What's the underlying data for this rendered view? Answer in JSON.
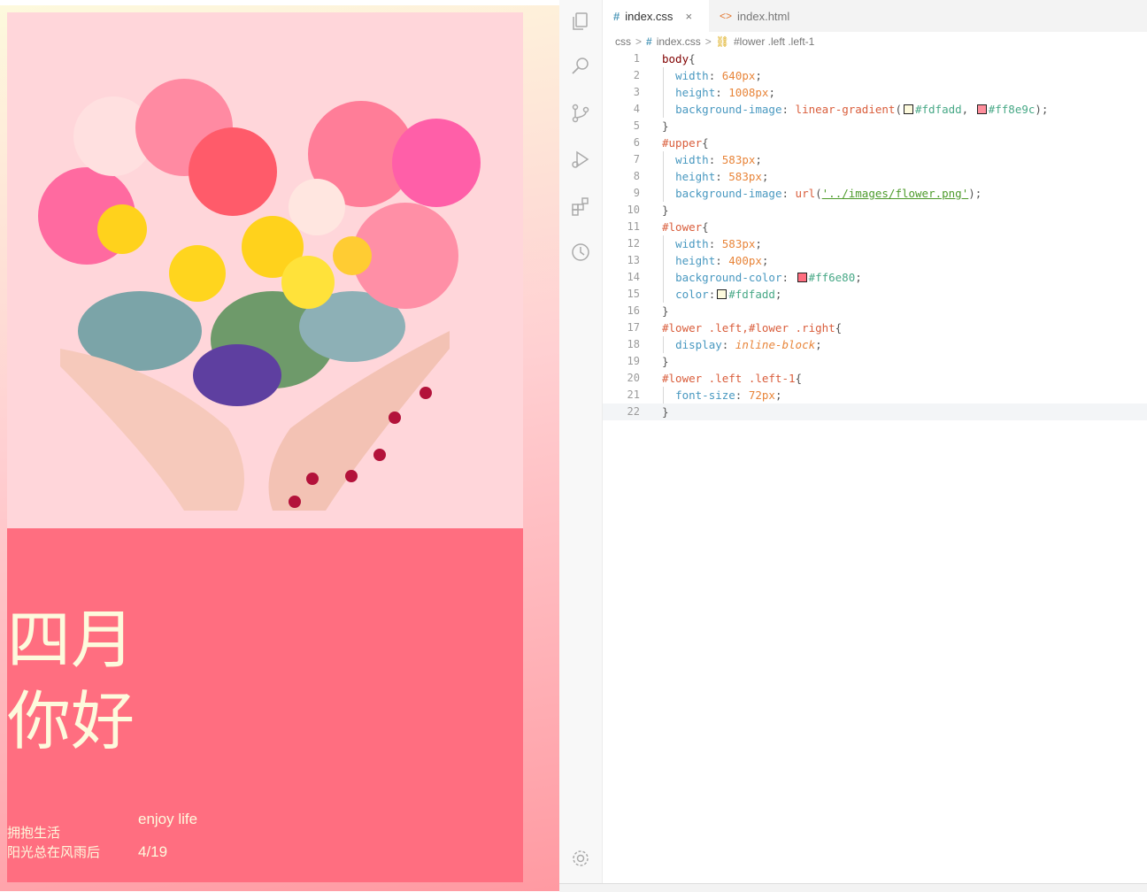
{
  "preview": {
    "heading_line1": "四月",
    "heading_line2": "你好",
    "left_line1": "拥抱生活",
    "left_line2": "阳光总在风雨后",
    "right_line1": "enjoy life",
    "right_line2": "4/19",
    "colors": {
      "body_gradient_start": "#fdfadd",
      "body_gradient_end": "#ff8e9c",
      "lower_bg": "#ff6e80",
      "text": "#fdfadd"
    }
  },
  "activity_bar": {
    "icons": [
      "files-icon",
      "search-icon",
      "source-control-icon",
      "run-debug-icon",
      "extensions-icon",
      "timeline-icon",
      "settings-gear-icon"
    ]
  },
  "tabs": [
    {
      "label": "index.css",
      "icon": "css-hash-icon",
      "active": true,
      "close": "×"
    },
    {
      "label": "index.html",
      "icon": "html-angle-icon",
      "active": false
    }
  ],
  "breadcrumb": {
    "folder": "css",
    "file": "index.css",
    "symbol": "#lower .left .left-1",
    "sep": ">"
  },
  "code": {
    "lines": [
      {
        "n": "1",
        "tokens": [
          [
            "sel",
            "body"
          ],
          [
            "pun",
            "{"
          ]
        ]
      },
      {
        "n": "2",
        "tokens": [
          [
            "prop",
            "width"
          ],
          [
            "pun",
            ": "
          ],
          [
            "num",
            "640px"
          ],
          [
            "pun",
            ";"
          ]
        ],
        "indent": true
      },
      {
        "n": "3",
        "tokens": [
          [
            "prop",
            "height"
          ],
          [
            "pun",
            ": "
          ],
          [
            "num",
            "1008px"
          ],
          [
            "pun",
            ";"
          ]
        ],
        "indent": true
      },
      {
        "n": "4",
        "tokens": [
          [
            "prop",
            "background-image"
          ],
          [
            "pun",
            ": "
          ],
          [
            "fn",
            "linear-gradient"
          ],
          [
            "pun",
            "("
          ],
          [
            "swatch",
            "#fdfadd"
          ],
          [
            "hex",
            "#fdfadd"
          ],
          [
            "pun",
            ", "
          ],
          [
            "swatch",
            "#ff8e9c"
          ],
          [
            "hex",
            "#ff8e9c"
          ],
          [
            "pun",
            ");"
          ]
        ],
        "indent": true
      },
      {
        "n": "5",
        "tokens": [
          [
            "pun",
            "}"
          ]
        ]
      },
      {
        "n": "6",
        "tokens": [
          [
            "idsel",
            "#upper"
          ],
          [
            "pun",
            "{"
          ]
        ]
      },
      {
        "n": "7",
        "tokens": [
          [
            "prop",
            "width"
          ],
          [
            "pun",
            ": "
          ],
          [
            "num",
            "583px"
          ],
          [
            "pun",
            ";"
          ]
        ],
        "indent": true
      },
      {
        "n": "8",
        "tokens": [
          [
            "prop",
            "height"
          ],
          [
            "pun",
            ": "
          ],
          [
            "num",
            "583px"
          ],
          [
            "pun",
            ";"
          ]
        ],
        "indent": true
      },
      {
        "n": "9",
        "tokens": [
          [
            "prop",
            "background-image"
          ],
          [
            "pun",
            ": "
          ],
          [
            "fn",
            "url"
          ],
          [
            "pun",
            "("
          ],
          [
            "str",
            "'../images/flower.png'"
          ],
          [
            "pun",
            ");"
          ]
        ],
        "indent": true
      },
      {
        "n": "10",
        "tokens": [
          [
            "pun",
            "}"
          ]
        ]
      },
      {
        "n": "11",
        "tokens": [
          [
            "idsel",
            "#lower"
          ],
          [
            "pun",
            "{"
          ]
        ]
      },
      {
        "n": "12",
        "tokens": [
          [
            "prop",
            "width"
          ],
          [
            "pun",
            ": "
          ],
          [
            "num",
            "583px"
          ],
          [
            "pun",
            ";"
          ]
        ],
        "indent": true
      },
      {
        "n": "13",
        "tokens": [
          [
            "prop",
            "height"
          ],
          [
            "pun",
            ": "
          ],
          [
            "num",
            "400px"
          ],
          [
            "pun",
            ";"
          ]
        ],
        "indent": true
      },
      {
        "n": "14",
        "tokens": [
          [
            "prop",
            "background-color"
          ],
          [
            "pun",
            ": "
          ],
          [
            "swatch",
            "#ff6e80"
          ],
          [
            "hex",
            "#ff6e80"
          ],
          [
            "pun",
            ";"
          ]
        ],
        "indent": true
      },
      {
        "n": "15",
        "tokens": [
          [
            "prop",
            "color"
          ],
          [
            "pun",
            ":"
          ],
          [
            "swatch",
            "#fdfadd"
          ],
          [
            "hex",
            "#fdfadd"
          ],
          [
            "pun",
            ";"
          ]
        ],
        "indent": true
      },
      {
        "n": "16",
        "tokens": [
          [
            "pun",
            "}"
          ]
        ]
      },
      {
        "n": "17",
        "tokens": [
          [
            "idsel",
            "#lower .left,#lower .right"
          ],
          [
            "pun",
            "{"
          ]
        ]
      },
      {
        "n": "18",
        "tokens": [
          [
            "prop",
            "display"
          ],
          [
            "pun",
            ": "
          ],
          [
            "kw",
            "inline-block"
          ],
          [
            "pun",
            ";"
          ]
        ],
        "indent": true
      },
      {
        "n": "19",
        "tokens": [
          [
            "pun",
            "}"
          ]
        ]
      },
      {
        "n": "20",
        "tokens": [
          [
            "idsel",
            "#lower .left .left-1"
          ],
          [
            "pun",
            "{"
          ]
        ]
      },
      {
        "n": "21",
        "tokens": [
          [
            "prop",
            "font-size"
          ],
          [
            "pun",
            ": "
          ],
          [
            "num",
            "72px"
          ],
          [
            "pun",
            ";"
          ]
        ],
        "indent": true
      },
      {
        "n": "22",
        "tokens": [
          [
            "pun",
            "}"
          ]
        ],
        "current": true
      }
    ]
  }
}
